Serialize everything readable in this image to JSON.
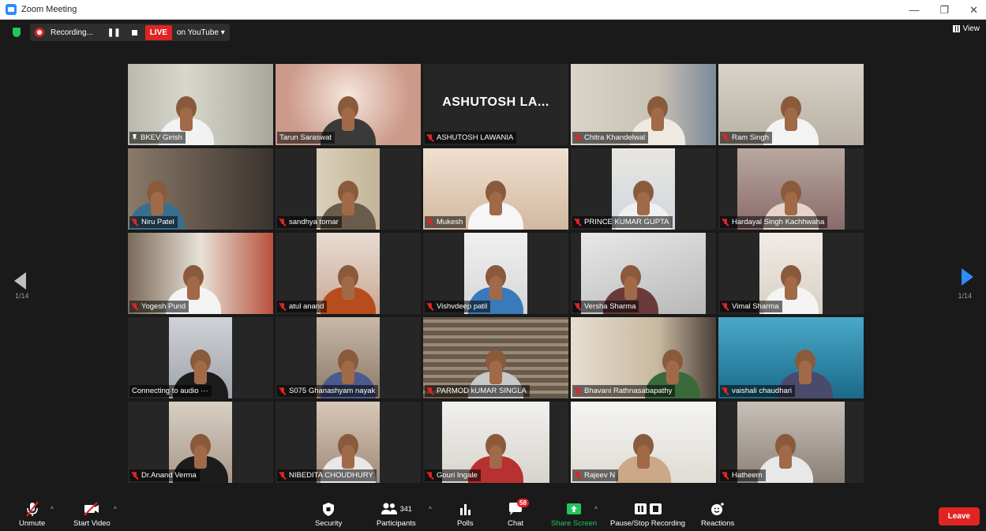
{
  "window": {
    "title": "Zoom Meeting",
    "controls": [
      "—",
      "❐",
      "✕"
    ]
  },
  "topbar": {
    "recording_label": "Recording...",
    "live_label": "LIVE",
    "live_target": "on YouTube ▾",
    "view_label": "View"
  },
  "pagination": {
    "left": "1/14",
    "right": "1/14"
  },
  "participants": [
    {
      "name": "BKEV Girish",
      "status": "pinned"
    },
    {
      "name": "Tarun Saraswat",
      "status": "none"
    },
    {
      "name": "ASHUTOSH LAWANIA",
      "status": "muted",
      "video_off_label": "ASHUTOSH LA..."
    },
    {
      "name": "Chitra Khandelwal",
      "status": "muted"
    },
    {
      "name": "Ram Singh",
      "status": "muted"
    },
    {
      "name": "Niru Patel",
      "status": "muted"
    },
    {
      "name": "sandhya tomar",
      "status": "muted"
    },
    {
      "name": "Mukesh",
      "status": "muted"
    },
    {
      "name": "PRINCE KUMAR GUPTA",
      "status": "muted"
    },
    {
      "name": "Hardayal Singh Kachhwaha",
      "status": "muted"
    },
    {
      "name": "Yogesh Pund",
      "status": "muted"
    },
    {
      "name": "atul anand",
      "status": "muted"
    },
    {
      "name": "Vishvdeep patil",
      "status": "muted"
    },
    {
      "name": "Versha Sharma",
      "status": "muted"
    },
    {
      "name": "Vimal Sharma",
      "status": "muted"
    },
    {
      "name": "Connecting to audio ···",
      "status": "none"
    },
    {
      "name": "S075 Ghanashyam nayak",
      "status": "muted"
    },
    {
      "name": "PARMOD kUMAR SINGLA",
      "status": "muted"
    },
    {
      "name": "Bhavani Rathnasabapathy",
      "status": "muted"
    },
    {
      "name": "vaishali chaudhari",
      "status": "muted"
    },
    {
      "name": "Dr.Anand Verma",
      "status": "muted"
    },
    {
      "name": "NIBEDITA CHOUDHURY",
      "status": "muted"
    },
    {
      "name": "Gouri Ingale",
      "status": "muted"
    },
    {
      "name": "Rajeev N",
      "status": "muted"
    },
    {
      "name": "Hatheem",
      "status": "muted"
    }
  ],
  "toolbar": {
    "unmute": "Unmute",
    "start_video": "Start Video",
    "security": "Security",
    "participants": "Participants",
    "participant_count": "341",
    "polls": "Polls",
    "chat": "Chat",
    "chat_badge": "58",
    "share_screen": "Share Screen",
    "pause_stop_recording": "Pause/Stop Recording",
    "reactions": "Reactions",
    "leave": "Leave"
  },
  "colors": {
    "live_red": "#e02424",
    "share_green": "#22c55e",
    "nav_blue": "#2d8cff",
    "speaker_border": "#c6d64a"
  }
}
